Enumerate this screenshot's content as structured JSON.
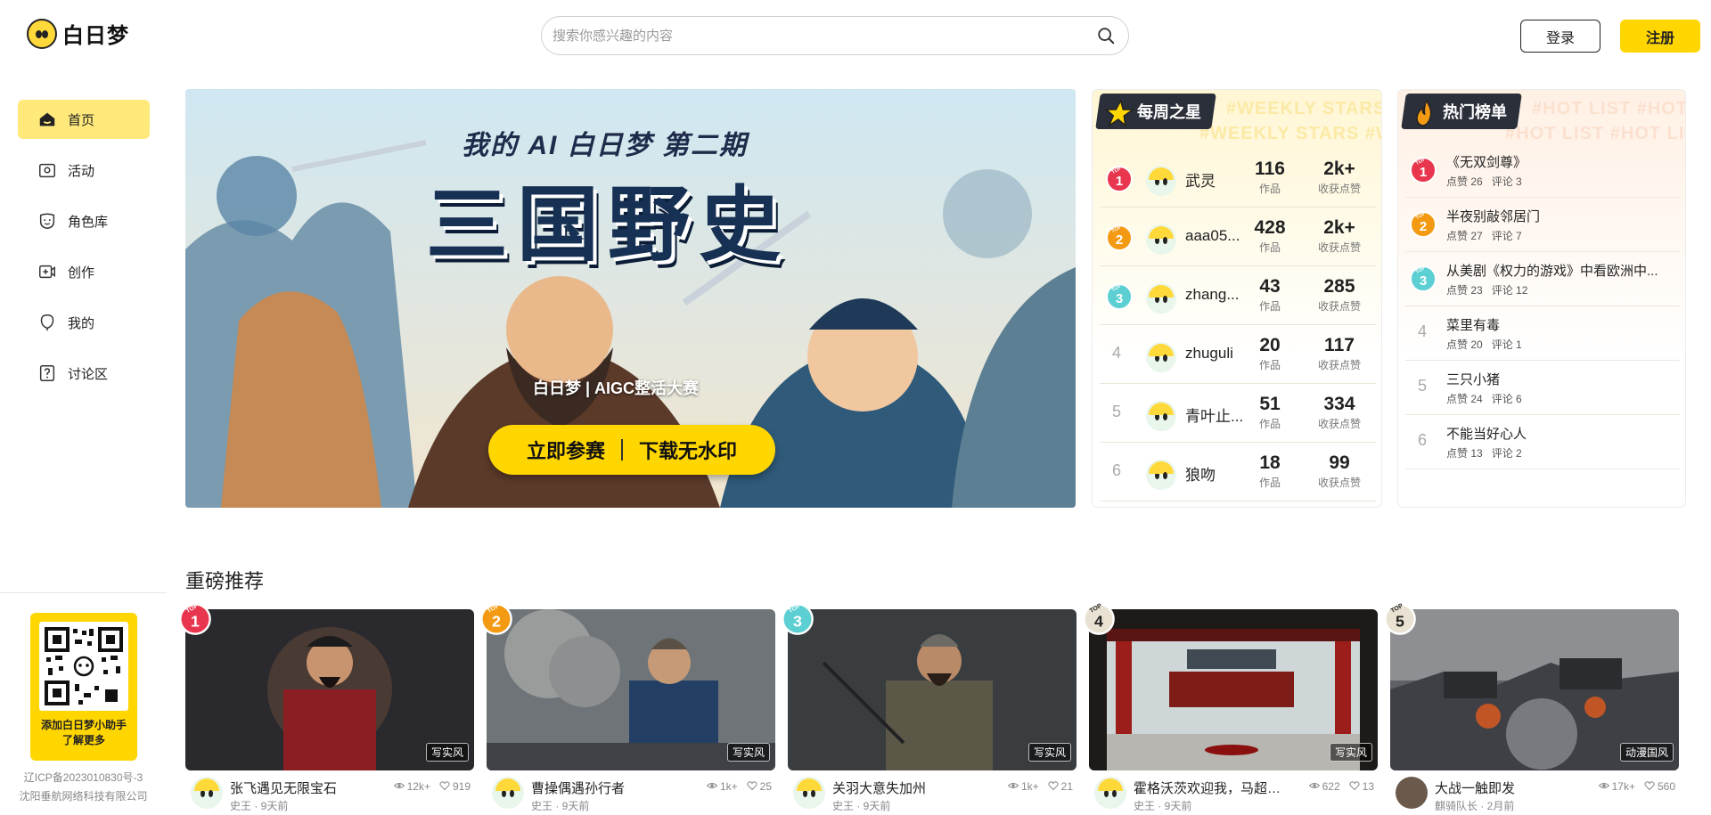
{
  "header": {
    "logo_text": "白日梦",
    "search_placeholder": "搜索你感兴趣的内容",
    "login_label": "登录",
    "register_label": "注册"
  },
  "sidebar": {
    "items": [
      {
        "label": "首页",
        "icon": "home-icon",
        "active": true
      },
      {
        "label": "活动",
        "icon": "activity-icon"
      },
      {
        "label": "角色库",
        "icon": "character-library-icon"
      },
      {
        "label": "创作",
        "icon": "create-icon"
      },
      {
        "label": "我的",
        "icon": "profile-icon"
      },
      {
        "label": "讨论区",
        "icon": "discussion-icon"
      }
    ],
    "qr_caption_line1": "添加白日梦小助手",
    "qr_caption_line2": "了解更多",
    "icp_line1": "辽ICP备2023010830号-3",
    "icp_line2": "沈阳垂航网络科技有限公司"
  },
  "banner": {
    "subtitle": "我的 AI 白日梦 第二期",
    "title": "三国野史",
    "brand": "白日梦 | AIGC整活大赛",
    "cta_join": "立即参赛",
    "cta_download": "下载无水印"
  },
  "weekly_stars": {
    "title": "每周之星",
    "watermark": "#WEEKLY STARS #WEEKLY STARS",
    "works_label": "作品",
    "likes_label": "收获点赞",
    "rows": [
      {
        "rank": "1",
        "name": "武灵",
        "works": "116",
        "likes": "2k+"
      },
      {
        "rank": "2",
        "name": "aaa05...",
        "works": "428",
        "likes": "2k+"
      },
      {
        "rank": "3",
        "name": "zhang...",
        "works": "43",
        "likes": "285"
      },
      {
        "rank": "4",
        "name": "zhuguli",
        "works": "20",
        "likes": "117"
      },
      {
        "rank": "5",
        "name": "青叶止...",
        "works": "51",
        "likes": "334"
      },
      {
        "rank": "6",
        "name": "狼吻",
        "works": "18",
        "likes": "99"
      }
    ]
  },
  "hot_list": {
    "title": "热门榜单",
    "watermark": "#HOT LIST #HOT LIST",
    "likes_prefix": "点赞",
    "comments_prefix": "评论",
    "rows": [
      {
        "rank": "1",
        "title": "《无双剑尊》",
        "likes": "点赞 26",
        "comments": "评论 3"
      },
      {
        "rank": "2",
        "title": "半夜别敲邻居门",
        "likes": "点赞 27",
        "comments": "评论 7"
      },
      {
        "rank": "3",
        "title": "从美剧《权力的游戏》中看欧洲中...",
        "likes": "点赞 23",
        "comments": "评论 12"
      },
      {
        "rank": "4",
        "title": "菜里有毒",
        "likes": "点赞 20",
        "comments": "评论 1"
      },
      {
        "rank": "5",
        "title": "三只小猪",
        "likes": "点赞 24",
        "comments": "评论 6"
      },
      {
        "rank": "6",
        "title": "不能当好心人",
        "likes": "点赞 13",
        "comments": "评论 2"
      }
    ]
  },
  "featured": {
    "title": "重磅推荐",
    "cards": [
      {
        "rank": "1",
        "title": "张飞遇见无限宝石",
        "author": "史王 · 9天前",
        "views": "12k+",
        "likes": "919",
        "tag": "写实风"
      },
      {
        "rank": "2",
        "title": "曹操偶遇孙行者",
        "author": "史王 · 9天前",
        "views": "1k+",
        "likes": "25",
        "tag": "写实风"
      },
      {
        "rank": "3",
        "title": "关羽大意失加州",
        "author": "史王 · 9天前",
        "views": "1k+",
        "likes": "21",
        "tag": "写实风"
      },
      {
        "rank": "4",
        "title": "霍格沃茨欢迎我，马超大...",
        "author": "史王 · 9天前",
        "views": "622",
        "likes": "13",
        "tag": "写实风"
      },
      {
        "rank": "5",
        "title": "大战一触即发",
        "author": "麒骑队长 · 2月前",
        "views": "17k+",
        "likes": "560",
        "tag": "动漫国风"
      }
    ]
  },
  "colors": {
    "accent": "#ffd600",
    "active_nav": "#ffe97a",
    "rank1": "#e8364f",
    "rank2": "#f39a12",
    "rank3": "#5ccfd3"
  }
}
